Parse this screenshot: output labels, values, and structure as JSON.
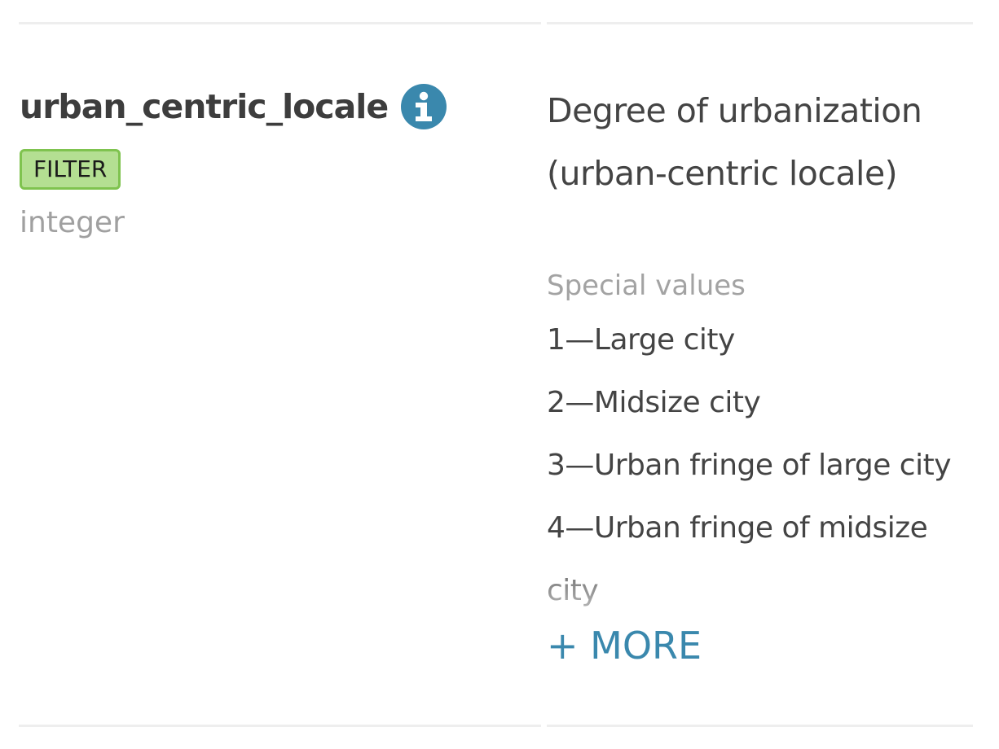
{
  "variable": {
    "name": "urban_centric_locale",
    "tag": "FILTER",
    "type": "integer",
    "info_icon": "info-icon"
  },
  "description": {
    "text": "Degree of urbanization (urban-centric locale)"
  },
  "special_values": {
    "heading": "Special values",
    "items": [
      "1—Large city",
      "2—Midsize city",
      "3—Urban fringe of large city",
      "4—Urban fringe of midsize city"
    ],
    "more_label": "+ MORE"
  },
  "colors": {
    "accent": "#3a88ad",
    "badge_bg": "#b4df92",
    "badge_border": "#7fc34f",
    "muted_text": "#a0a0a0",
    "body_text": "#444444"
  }
}
